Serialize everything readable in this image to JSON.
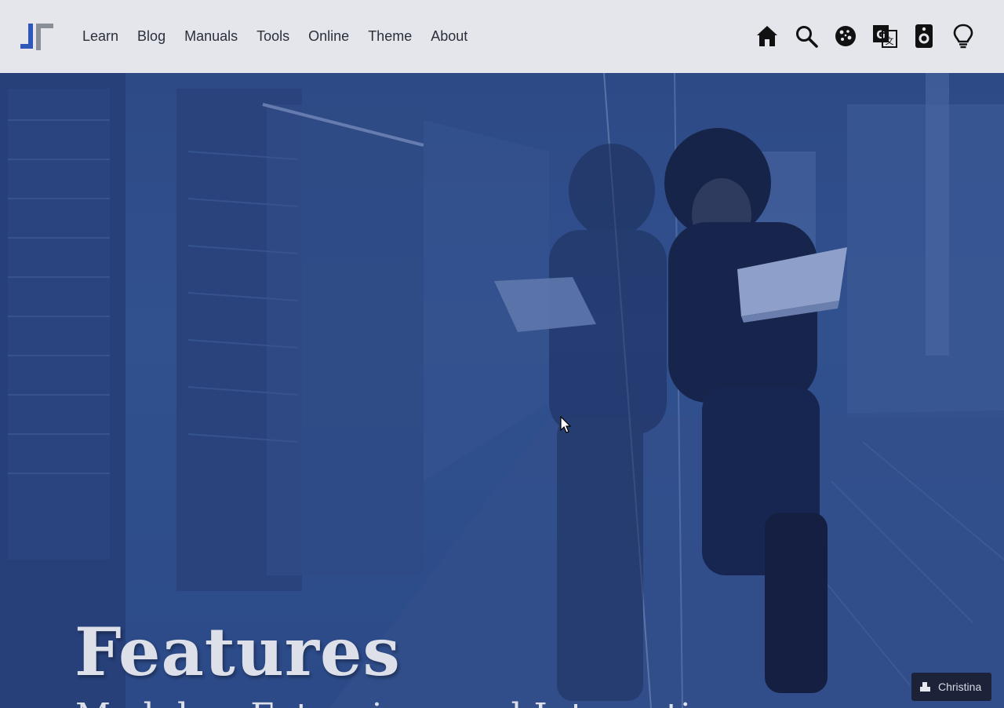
{
  "nav": {
    "items": [
      {
        "label": "Learn"
      },
      {
        "label": "Blog"
      },
      {
        "label": "Manuals"
      },
      {
        "label": "Tools"
      },
      {
        "label": "Online"
      },
      {
        "label": "Theme"
      },
      {
        "label": "About"
      }
    ]
  },
  "header_icons": [
    "home-icon",
    "search-icon",
    "cookie-icon",
    "translate-icon",
    "speaker-icon",
    "lightbulb-icon"
  ],
  "hero": {
    "title": "Features",
    "subtitle": "Modules, Extensions and Integrations"
  },
  "user_badge": {
    "name": "Christina"
  },
  "colors": {
    "header_bg": "#e4e6ec",
    "hero_tint": "#2f4a86",
    "title_text": "#dde0e8",
    "logo_blue": "#2f56b8",
    "logo_gray": "#8a8e98"
  }
}
